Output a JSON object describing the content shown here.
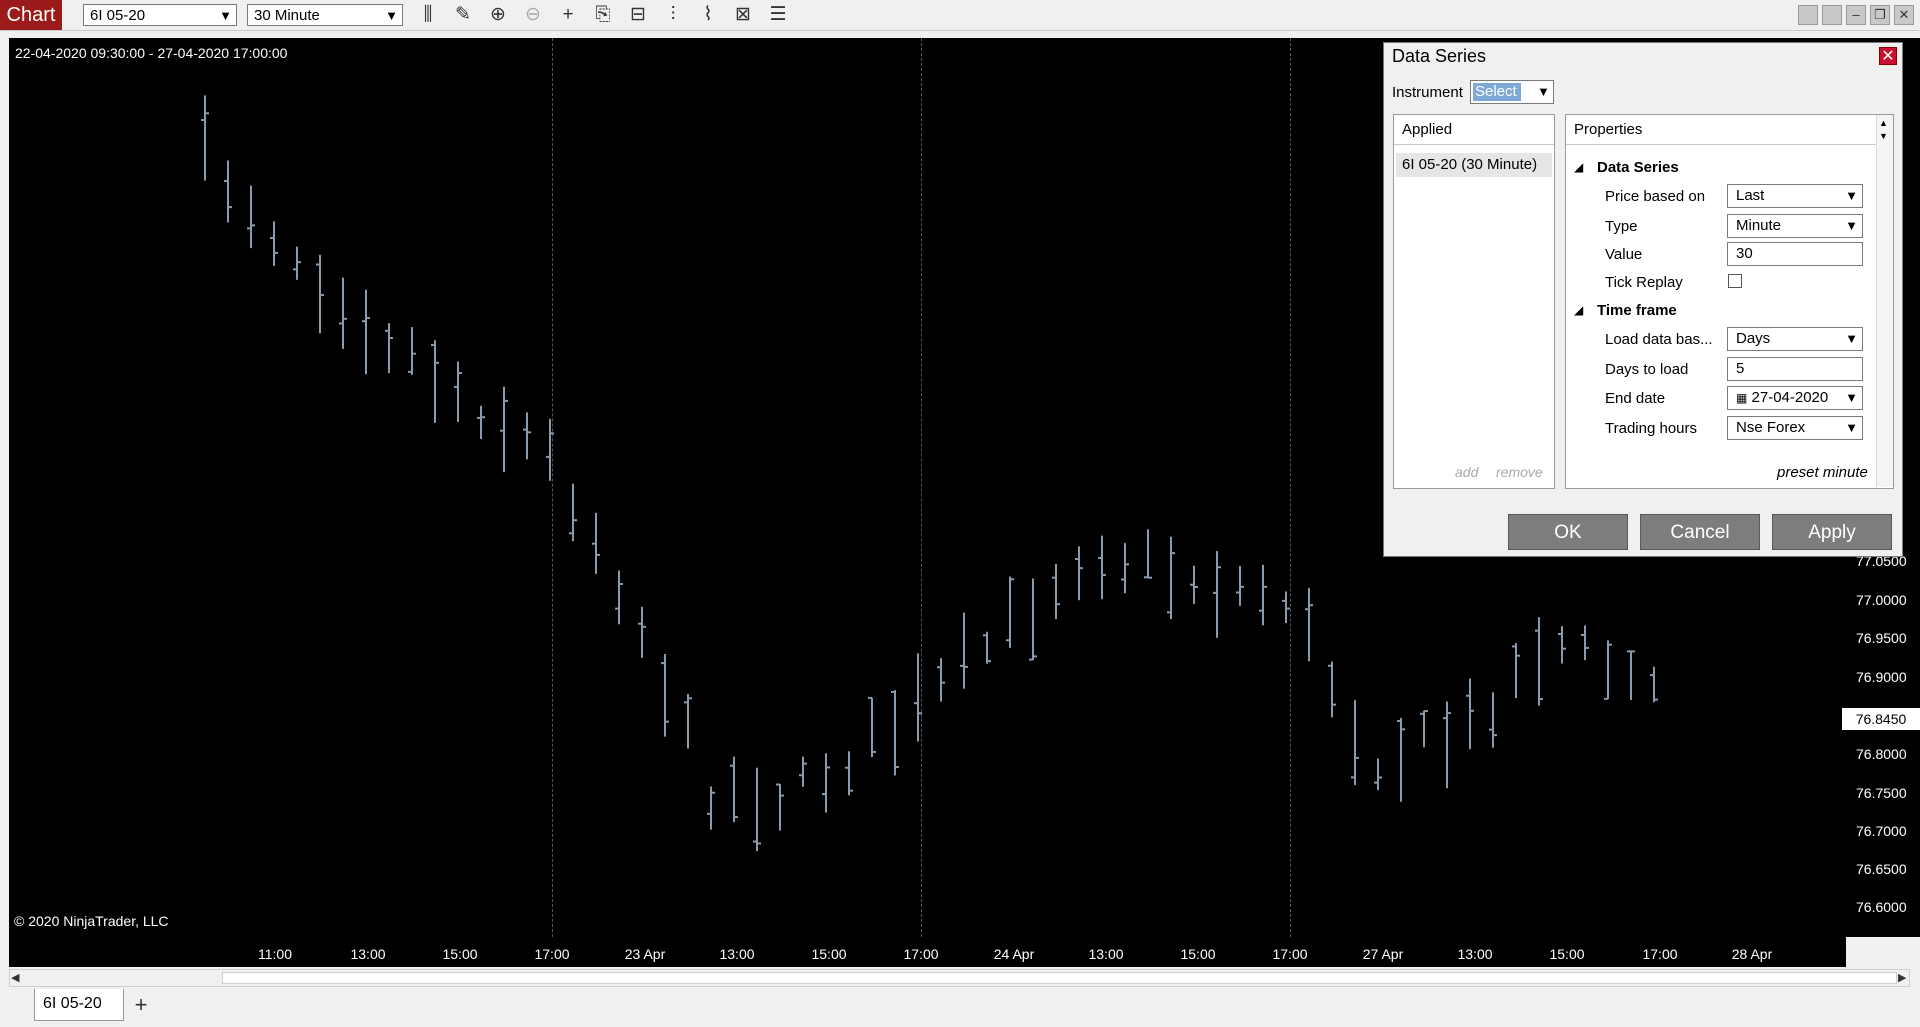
{
  "toolbar": {
    "chart_tab": "Chart",
    "instrument": "6I 05-20",
    "interval": "30 Minute",
    "icons": [
      "bar-type-icon",
      "pencil-icon",
      "zoom-in-icon",
      "zoom-out-icon",
      "crosshair-icon",
      "data-series-icon",
      "properties-icon",
      "indicators-icon",
      "strategies-icon",
      "templates-icon",
      "list-icon"
    ]
  },
  "chart": {
    "date_range": "22-04-2020 09:30:00 - 27-04-2020 17:00:00",
    "copyright": "© 2020 NinjaTrader, LLC",
    "last_price": "76.8450",
    "price_ticks": [
      "77.0500",
      "77.0000",
      "76.9500",
      "76.9000",
      "76.8000",
      "76.7500",
      "76.7000",
      "76.6500",
      "76.6000"
    ],
    "time_ticks": [
      "11:00",
      "13:00",
      "15:00",
      "17:00",
      "23 Apr",
      "13:00",
      "15:00",
      "17:00",
      "24 Apr",
      "13:00",
      "15:00",
      "17:00",
      "27 Apr",
      "13:00",
      "15:00",
      "17:00",
      "28 Apr"
    ],
    "bar_color": "#8a9aad"
  },
  "dialog": {
    "title": "Data Series",
    "instrument_label": "Instrument",
    "instrument_value": "Select",
    "applied_header": "Applied",
    "applied_items": [
      "6I 05-20 (30 Minute)"
    ],
    "add_label": "add",
    "remove_label": "remove",
    "properties_header": "Properties",
    "section_data_series": "Data Series",
    "price_based_on_label": "Price based on",
    "price_based_on_value": "Last",
    "type_label": "Type",
    "type_value": "Minute",
    "value_label": "Value",
    "value_value": "30",
    "tick_replay_label": "Tick Replay",
    "section_time_frame": "Time frame",
    "load_data_label": "Load data bas...",
    "load_data_value": "Days",
    "days_to_load_label": "Days to load",
    "days_to_load_value": "5",
    "end_date_label": "End date",
    "end_date_value": "27-04-2020",
    "trading_hours_label": "Trading hours",
    "trading_hours_value": "Nse Forex",
    "preset_label": "preset minute",
    "ok_label": "OK",
    "cancel_label": "Cancel",
    "apply_label": "Apply"
  },
  "bottom": {
    "tab_label": "6I 05-20",
    "add_tab": "+"
  }
}
